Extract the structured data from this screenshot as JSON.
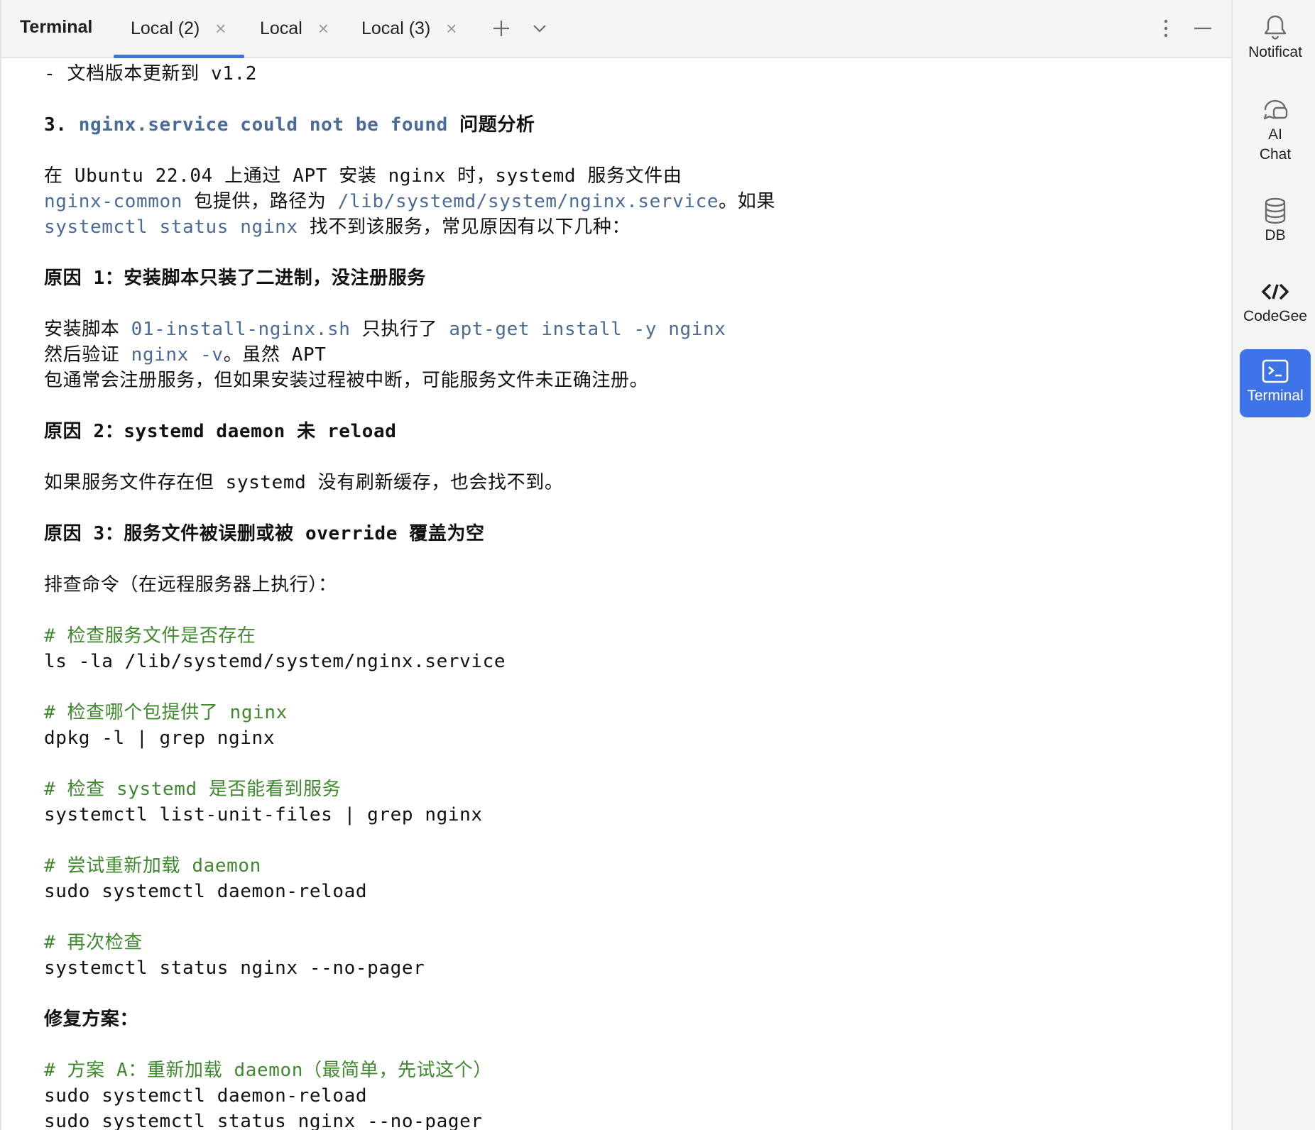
{
  "panel": {
    "title": "Terminal"
  },
  "tabs": [
    {
      "label": "Local (2)",
      "active": true
    },
    {
      "label": "Local",
      "active": false
    },
    {
      "label": "Local (3)",
      "active": false
    }
  ],
  "toolbar": {
    "new_tab": "+",
    "dropdown": "chevron-down",
    "more": "more-vertical",
    "minimize": "minimize"
  },
  "sidebar": {
    "items": [
      {
        "label": "Notificat",
        "icon": "bell-icon"
      },
      {
        "label_line1": "AI",
        "label_line2": "Chat",
        "icon": "ai-chat-icon"
      },
      {
        "label": "DB",
        "icon": "database-icon"
      },
      {
        "label": "CodeGee",
        "icon": "codegeex-icon"
      },
      {
        "label": "Terminal",
        "icon": "terminal-icon",
        "active": true
      }
    ]
  },
  "colors": {
    "accent": "#3e74e8",
    "code_text": "#4a6a9a",
    "comment": "#3f8a2e"
  },
  "output": {
    "l01": "- 文档版本更新到 v1.2",
    "l03a": "3. ",
    "l03b": "nginx.service could not be found",
    "l03c": " 问题分析",
    "l05": "在 Ubuntu 22.04 上通过 APT 安装 nginx 时，systemd 服务文件由",
    "l06a": "nginx-common",
    "l06b": " 包提供，路径为 ",
    "l06c": "/lib/systemd/system/nginx.service",
    "l06d": "。如果",
    "l07a": "systemctl status nginx",
    "l07b": " 找不到该服务，常见原因有以下几种：",
    "l09": "原因 1：安装脚本只装了二进制，没注册服务",
    "l11a": "安装脚本 ",
    "l11b": "01-install-nginx.sh",
    "l11c": " 只执行了 ",
    "l11d": "apt-get install -y nginx",
    "l12a": "然后验证 ",
    "l12b": "nginx -v",
    "l12c": "。虽然 APT",
    "l13": "包通常会注册服务，但如果安装过程被中断，可能服务文件未正确注册。",
    "l15": "原因 2：systemd daemon 未 reload",
    "l17": "如果服务文件存在但 systemd 没有刷新缓存，也会找不到。",
    "l19": "原因 3：服务文件被误删或被 override 覆盖为空",
    "l21": "排查命令（在远程服务器上执行）：",
    "l23": "# 检查服务文件是否存在",
    "l24": "ls -la /lib/systemd/system/nginx.service",
    "l26": "# 检查哪个包提供了 nginx",
    "l27": "dpkg -l | grep nginx",
    "l29": "# 检查 systemd 是否能看到服务",
    "l30": "systemctl list-unit-files | grep nginx",
    "l32": "# 尝试重新加载 daemon",
    "l33": "sudo systemctl daemon-reload",
    "l35": "# 再次检查",
    "l36": "systemctl status nginx --no-pager",
    "l38": "修复方案：",
    "l40": "# 方案 A：重新加载 daemon（最简单，先试这个）",
    "l41": "sudo systemctl daemon-reload",
    "l42": "sudo systemctl status nginx --no-pager"
  }
}
